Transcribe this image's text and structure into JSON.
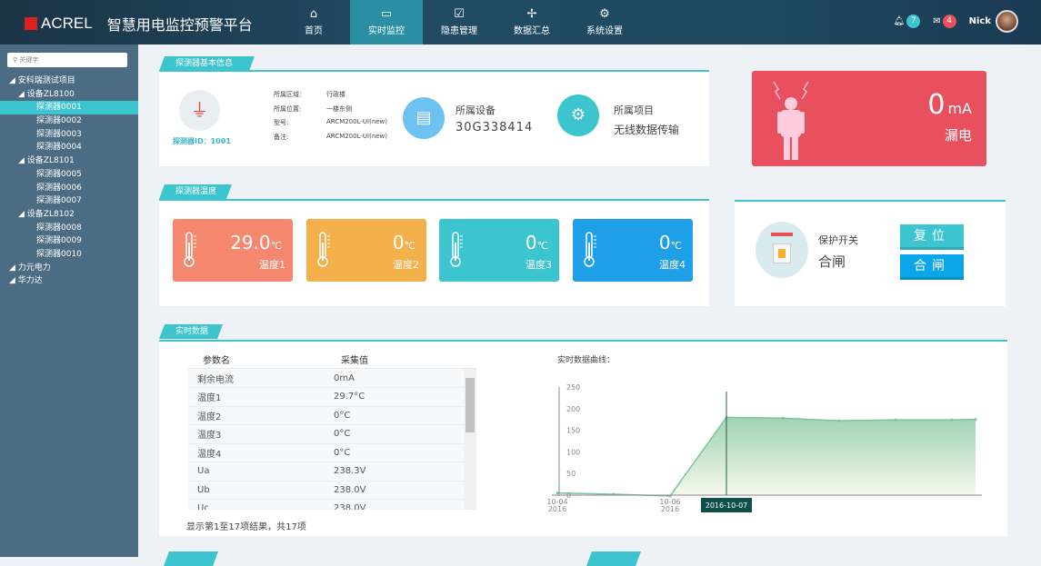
{
  "header": {
    "brand": "ACREL",
    "title": "智慧用电监控预警平台",
    "nav": [
      {
        "label": "首页",
        "icon": "home-icon"
      },
      {
        "label": "实时监控",
        "icon": "monitor-icon",
        "active": true
      },
      {
        "label": "隐患管理",
        "icon": "clipboard-icon"
      },
      {
        "label": "数据汇总",
        "icon": "pinwheel-icon"
      },
      {
        "label": "系统设置",
        "icon": "gears-icon"
      }
    ],
    "notifications": "7",
    "messages": "4",
    "user": "Nick",
    "colors": {
      "notif": "#3cc4cf",
      "msg": "#e8505e"
    }
  },
  "sidebar": {
    "search_placeholder": "关键字",
    "tree": [
      {
        "label": "◢ 安科瑞测试项目",
        "level": 0
      },
      {
        "label": "◢ 设备ZL8100",
        "level": 1
      },
      {
        "label": "探测器0001",
        "level": 2,
        "active": true
      },
      {
        "label": "探测器0002",
        "level": 2
      },
      {
        "label": "探测器0003",
        "level": 2
      },
      {
        "label": "探测器0004",
        "level": 2
      },
      {
        "label": "◢ 设备ZL8101",
        "level": 1
      },
      {
        "label": "探测器0005",
        "level": 2
      },
      {
        "label": "探测器0006",
        "level": 2
      },
      {
        "label": "探测器0007",
        "level": 2
      },
      {
        "label": "◢ 设备ZL8102",
        "level": 1
      },
      {
        "label": "探测器0008",
        "level": 2
      },
      {
        "label": "探测器0009",
        "level": 2
      },
      {
        "label": "探测器0010",
        "level": 2
      },
      {
        "label": "◢ 力元电力",
        "level": 0
      },
      {
        "label": "◢ 华力达",
        "level": 0
      }
    ]
  },
  "basic": {
    "title": "探测器基本信息",
    "detector_id": "探测器ID：1001",
    "fields": [
      {
        "k": "所属区域：",
        "v": "行政楼"
      },
      {
        "k": "所属位置:",
        "v": "一楼东侧"
      },
      {
        "k": "型号:",
        "v": "ARCM200L-UI(new)"
      },
      {
        "k": "备注:",
        "v": "ARCM200L-UI(new)"
      }
    ],
    "device_label": "所属设备",
    "device_value": "30G338414",
    "project_label": "所属项目",
    "project_value": "无线数据传输"
  },
  "leak": {
    "value": "0",
    "unit": "mA",
    "label": "漏电",
    "color": "#e8505e"
  },
  "temp": {
    "title": "探测器温度",
    "cards": [
      {
        "value": "29.0",
        "unit": "℃",
        "label": "温度1",
        "color": "#f5886f"
      },
      {
        "value": "0",
        "unit": "℃",
        "label": "温度2",
        "color": "#f4b04a"
      },
      {
        "value": "0",
        "unit": "℃",
        "label": "温度3",
        "color": "#3cc4cf"
      },
      {
        "value": "0",
        "unit": "℃",
        "label": "温度4",
        "color": "#1f9fe8"
      }
    ]
  },
  "switch": {
    "label": "保护开关",
    "state": "合闸",
    "reset_btn": "复位",
    "close_btn": "合闸"
  },
  "realtime": {
    "title": "实时数据",
    "headers": [
      "参数名",
      "采集值"
    ],
    "rows": [
      [
        "剩余电流",
        "0mA"
      ],
      [
        "温度1",
        "29.7°C"
      ],
      [
        "温度2",
        "0°C"
      ],
      [
        "温度3",
        "0°C"
      ],
      [
        "温度4",
        "0°C"
      ],
      [
        "Ua",
        "238.3V"
      ],
      [
        "Ub",
        "238.0V"
      ],
      [
        "Uc",
        "238.0V"
      ]
    ],
    "footer": "显示第1至17项结果，共17项",
    "chart_title": "实时数据曲线："
  },
  "chart_data": {
    "type": "area",
    "ylim": [
      0,
      250
    ],
    "yticks": [
      "250",
      "200",
      "150",
      "100",
      "50",
      "0"
    ],
    "xticks": [
      {
        "l1": "10-04",
        "l2": "2016"
      },
      {
        "l1": "10-06",
        "l2": "2016"
      }
    ],
    "values": [
      5,
      2,
      -2,
      180,
      178,
      172,
      174,
      174,
      175
    ],
    "tooltip": "2016-10-07",
    "color": "#7cc49a"
  }
}
